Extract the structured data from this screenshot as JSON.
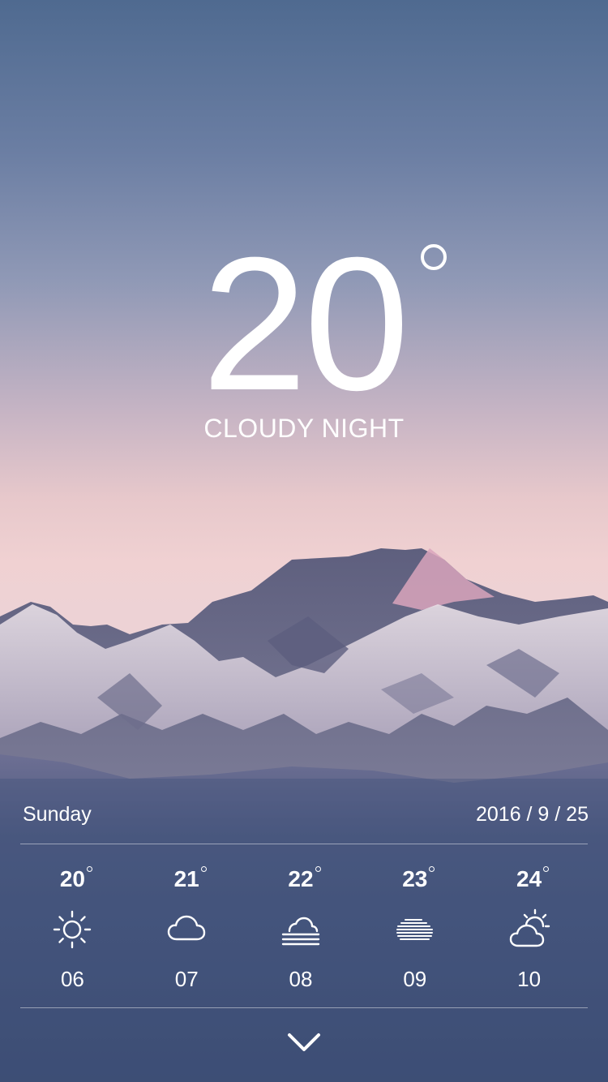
{
  "current": {
    "temperature": "20",
    "condition": "CLOUDY NIGHT"
  },
  "date_row": {
    "day": "Sunday",
    "date": "2016 / 9 / 25"
  },
  "forecast": [
    {
      "temp": "20",
      "icon": "sun-icon",
      "hour": "06"
    },
    {
      "temp": "21",
      "icon": "cloud-icon",
      "hour": "07"
    },
    {
      "temp": "22",
      "icon": "fog-icon",
      "hour": "08"
    },
    {
      "temp": "23",
      "icon": "haze-icon",
      "hour": "09"
    },
    {
      "temp": "24",
      "icon": "partly-cloudy-icon",
      "hour": "10"
    }
  ],
  "controls": {
    "expand_icon": "chevron-down-icon"
  },
  "colors": {
    "sky_top": "#4f6a90",
    "sky_bottom": "#f0d1d2",
    "ground": "#3f5078",
    "text": "#ffffff"
  }
}
